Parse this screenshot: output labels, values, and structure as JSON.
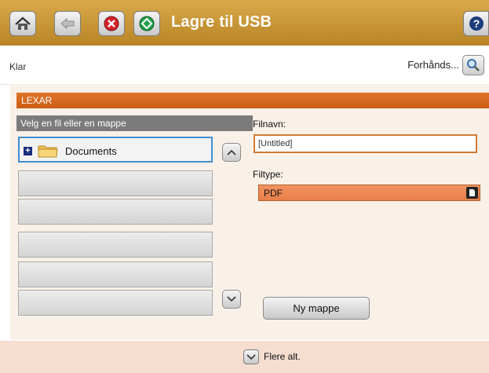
{
  "header": {
    "title": "Lagre til USB",
    "icons": {
      "home": "home-icon",
      "back": "back-arrow-icon",
      "stop": "stop-icon",
      "start": "start-icon",
      "help": "help-icon"
    },
    "colors": {
      "bar": "#c99734",
      "stop": "#d2242a",
      "start": "#25a04a"
    }
  },
  "status": {
    "text": "Klar",
    "preview_label": "Forhånds...",
    "preview_icon": "magnifier-icon"
  },
  "drive": {
    "name": "LEXAR",
    "color": "#d96a20"
  },
  "file_list": {
    "header": "Velg en fil eller en mappe",
    "items": [
      {
        "label": "Documents",
        "icon": "folder-icon",
        "expand_icon": "expand-plus-icon",
        "selected": true
      },
      {
        "label": ""
      },
      {
        "label": ""
      },
      {
        "label": ""
      },
      {
        "label": ""
      },
      {
        "label": ""
      }
    ],
    "scroll_up_icon": "chevron-up-icon",
    "scroll_down_icon": "chevron-down-icon"
  },
  "form": {
    "filename_label": "Filnavn:",
    "filename_value": "[Untitled]",
    "filetype_label": "Filtype:",
    "filetype_value": "PDF",
    "new_folder_label": "Ny mappe"
  },
  "footer": {
    "more_label": "Flere alt.",
    "more_icon": "chevron-down-icon"
  }
}
